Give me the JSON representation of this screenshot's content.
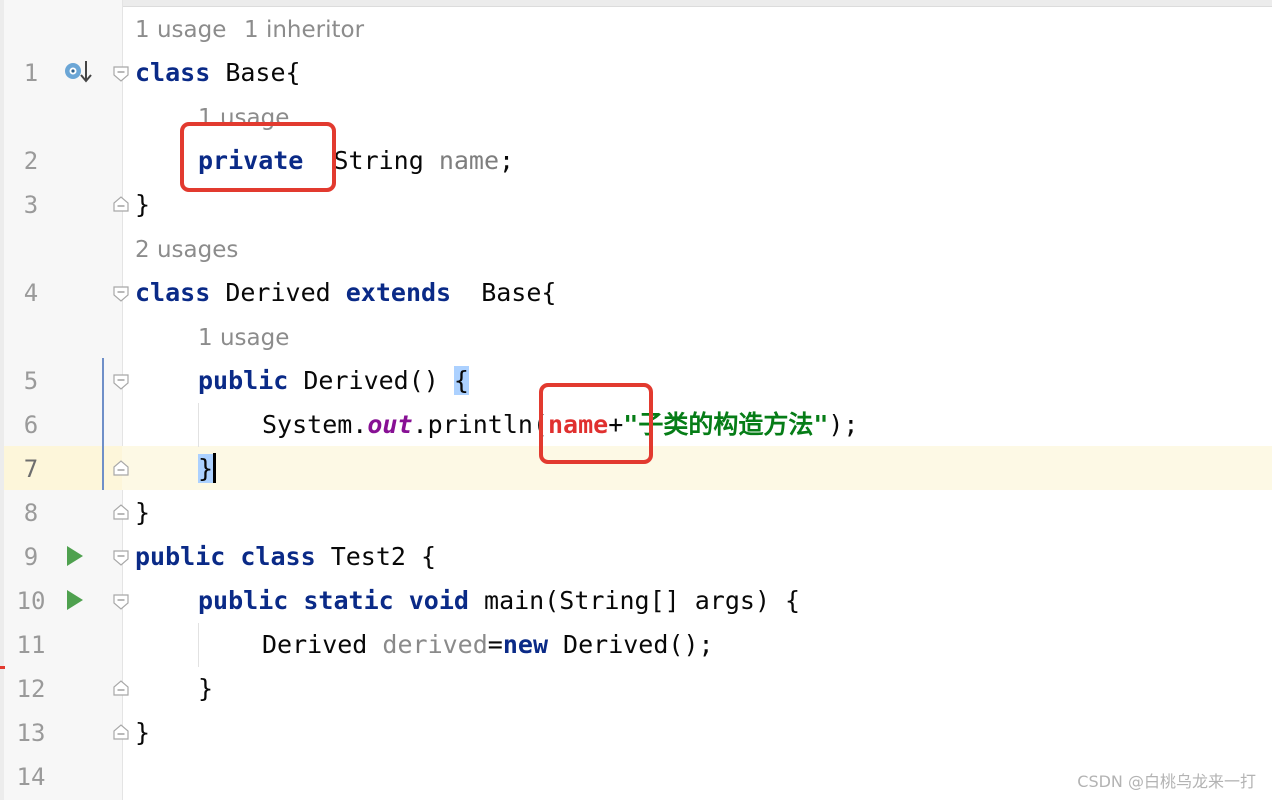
{
  "inlay_hints": {
    "base": [
      "1 usage",
      "1 inheritor"
    ],
    "name_field": "1 usage",
    "derived_class": "2 usages",
    "derived_ctor": "1 usage"
  },
  "line_numbers": [
    "1",
    "2",
    "3",
    "4",
    "5",
    "6",
    "7",
    "8",
    "9",
    "10",
    "11",
    "12",
    "13",
    "14"
  ],
  "code": {
    "l1": {
      "kw": "class",
      "rest": " Base{"
    },
    "l2": {
      "kw": "private",
      "sp": "  String ",
      "field": "name",
      "end": ";"
    },
    "l3": {
      "text": "}"
    },
    "l4": {
      "kw1": "class",
      "mid": " Derived ",
      "kw2": "extends",
      "rest": "  Base{"
    },
    "l5": {
      "kw": "public",
      "rest": " Derived() ",
      "brace": "{"
    },
    "l6": {
      "pre": "System.",
      "static_field": "out",
      "mid": ".println(",
      "field": "name",
      "plus": "+",
      "str": "\"子类的构造方法\"",
      "end": ");"
    },
    "l7": {
      "brace": "}"
    },
    "l8": {
      "text": "}"
    },
    "l9": {
      "kw1": "public",
      "kw2": "class",
      "rest": " Test2 {"
    },
    "l10": {
      "kw1": "public",
      "kw2": "static",
      "kw3": "void",
      "rest": " main(String[] args) {"
    },
    "l11": {
      "pre": "Derived ",
      "var": "derived",
      "eq": "=",
      "kw": "new",
      "rest": " Derived();"
    },
    "l12": {
      "text": "}"
    },
    "l13": {
      "text": "}"
    }
  },
  "watermark": "CSDN @白桃乌龙来一打",
  "colors": {
    "keyword": "#0a2a87",
    "field": "#7e7e7e",
    "string": "#067d17",
    "static_field": "#871094",
    "annotation_box": "#e23a2f",
    "current_line": "#fdf9e5"
  }
}
